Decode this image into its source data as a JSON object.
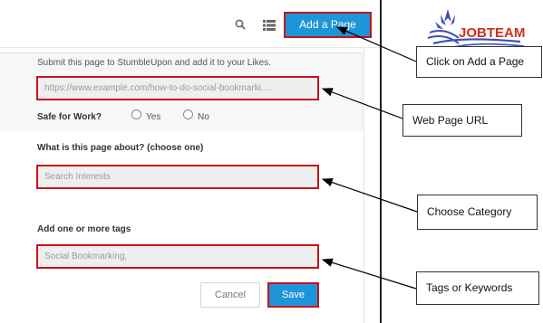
{
  "toolbar": {
    "add_page_label": "Add a Page"
  },
  "form": {
    "intro_text": "Submit this page to StumbleUpon and add it to your Likes.",
    "url_value": "https://www.example.com/how-to-do-social-bookmarki....",
    "safe_label": "Safe for Work?",
    "yes_label": "Yes",
    "no_label": "No",
    "about_label": "What is this page about? (choose one)",
    "interest_placeholder": "Search Interests",
    "tags_label": "Add one or more tags",
    "tags_value": "Social Bookmarking,",
    "cancel_label": "Cancel",
    "save_label": "Save"
  },
  "callouts": {
    "add_page": "Click on Add a Page",
    "url": "Web Page URL",
    "category": "Choose Category",
    "tags": "Tags or Keywords"
  },
  "logo": {
    "text": "JOBTEAM"
  },
  "colors": {
    "accent": "#1e95d8",
    "highlight_border": "#c8111b",
    "logo_text": "#d32d1f",
    "logo_icon": "#3d4fb8"
  }
}
